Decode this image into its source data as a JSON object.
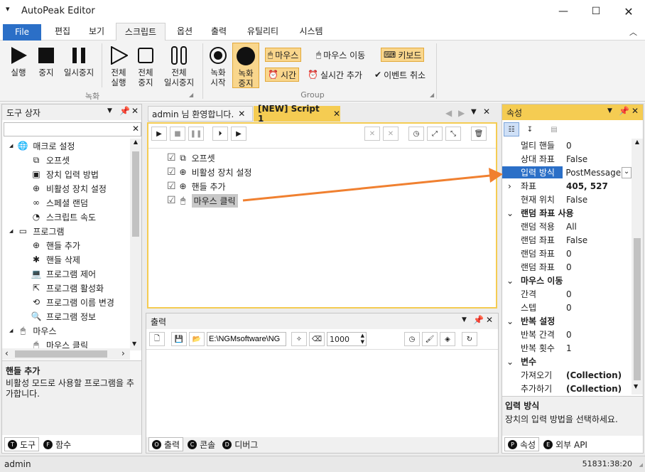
{
  "app": {
    "title": "AutoPeak Editor"
  },
  "menu": {
    "file": "File",
    "tabs": [
      "편집",
      "보기",
      "스크립트",
      "옵션",
      "출력",
      "유틸리티",
      "시스템"
    ]
  },
  "ribbon": {
    "run": "실행",
    "stop": "중지",
    "pause": "일시중지",
    "run_all": [
      "전체",
      "실행"
    ],
    "stop_all": [
      "전체",
      "중지"
    ],
    "pause_all": [
      "전체",
      "일시중지"
    ],
    "rec_start": [
      "녹화",
      "시작"
    ],
    "rec_stop": [
      "녹화",
      "중지"
    ],
    "group_record": "녹화",
    "group_group": "Group",
    "mouse": "마우스",
    "mouse_move": "마우스 이동",
    "keyboard": "키보드",
    "time": "시간",
    "realtime_add": "실시간 추가",
    "event_cancel": "이벤트 취소"
  },
  "toolbox": {
    "title": "도구 상자",
    "search_value": "",
    "items": [
      {
        "label": "매크로 설정",
        "level": 0,
        "icon": "globe-icon"
      },
      {
        "label": "오프셋",
        "level": 1,
        "icon": "offset-icon"
      },
      {
        "label": "장치 입력 방법",
        "level": 1,
        "icon": "input-method-icon"
      },
      {
        "label": "비활성 장치 설정",
        "level": 1,
        "icon": "crosshair-icon"
      },
      {
        "label": "스페셜 랜덤",
        "level": 1,
        "icon": "infinity-icon"
      },
      {
        "label": "스크립트 속도",
        "level": 1,
        "icon": "speed-icon"
      },
      {
        "label": "프로그램",
        "level": 0,
        "icon": "window-icon"
      },
      {
        "label": "핸들 추가",
        "level": 1,
        "icon": "crosshair-icon"
      },
      {
        "label": "핸들 삭제",
        "level": 1,
        "icon": "handle-delete-icon"
      },
      {
        "label": "프로그램 제어",
        "level": 1,
        "icon": "laptop-icon"
      },
      {
        "label": "프로그램 활성화",
        "level": 1,
        "icon": "activate-icon"
      },
      {
        "label": "프로그램 이름 변경",
        "level": 1,
        "icon": "rename-icon"
      },
      {
        "label": "프로그램 정보",
        "level": 1,
        "icon": "magnifier-icon"
      },
      {
        "label": "마우스",
        "level": 0,
        "icon": "mouse-icon"
      },
      {
        "label": "마우스 클릭",
        "level": 1,
        "icon": "mouse-click-icon"
      }
    ],
    "desc_title": "핸들 추가",
    "desc_text": "비활성 모드로 사용할 프로그램을 추가합니다.",
    "tabs": [
      {
        "badge": "T",
        "label": "도구"
      },
      {
        "badge": "F",
        "label": "함수"
      }
    ]
  },
  "editor": {
    "tabs": [
      "admin 님 환영합니다.",
      "[NEW] Script 1"
    ],
    "lines": [
      {
        "label": "오프셋",
        "icon": "offset-icon"
      },
      {
        "label": "비활성 장치 설정",
        "icon": "crosshair-icon"
      },
      {
        "label": "핸들 추가",
        "icon": "crosshair-icon"
      },
      {
        "label": "마우스 클릭",
        "icon": "mouse-click-icon"
      }
    ]
  },
  "output": {
    "title": "출력",
    "path": "E:\\NGMsoftware\\NG",
    "count": "1000",
    "tabs": [
      {
        "badge": "O",
        "label": "출력"
      },
      {
        "badge": "C",
        "label": "콘솔"
      },
      {
        "badge": "D",
        "label": "디버그"
      }
    ]
  },
  "properties": {
    "title": "속성",
    "rows": [
      {
        "type": "prop",
        "name": "멀티 핸들",
        "value": "0"
      },
      {
        "type": "prop",
        "name": "상대 좌표",
        "value": "False"
      },
      {
        "type": "prop",
        "name": "입력 방식",
        "value": "PostMessage",
        "selected": true
      },
      {
        "type": "prop",
        "name": "좌표",
        "value": "405, 527",
        "bold": true,
        "expand": true
      },
      {
        "type": "prop",
        "name": "현재 위치",
        "value": "False"
      },
      {
        "type": "cat",
        "name": "랜덤 좌표 사용"
      },
      {
        "type": "prop",
        "name": "랜덤 적용",
        "value": "All"
      },
      {
        "type": "prop",
        "name": "랜덤 좌표",
        "value": "False"
      },
      {
        "type": "prop",
        "name": "랜덤 좌표",
        "value": "0"
      },
      {
        "type": "prop",
        "name": "랜덤 좌표",
        "value": "0"
      },
      {
        "type": "cat",
        "name": "마우스 이동"
      },
      {
        "type": "prop",
        "name": "간격",
        "value": "0"
      },
      {
        "type": "prop",
        "name": "스텝",
        "value": "0"
      },
      {
        "type": "cat",
        "name": "반복 설정"
      },
      {
        "type": "prop",
        "name": "반복 간격",
        "value": "0"
      },
      {
        "type": "prop",
        "name": "반복 횟수",
        "value": "1"
      },
      {
        "type": "cat",
        "name": "변수"
      },
      {
        "type": "prop",
        "name": "가져오기",
        "value": "(Collection)",
        "bold": true
      },
      {
        "type": "prop",
        "name": "추가하기",
        "value": "(Collection)",
        "bold": true
      }
    ],
    "desc_title": "입력 방식",
    "desc_text": "장치의 입력 방법을 선택하세요.",
    "tabs": [
      {
        "badge": "P",
        "label": "속성"
      },
      {
        "badge": "E",
        "label": "외부 API"
      }
    ]
  },
  "status": {
    "user": "admin",
    "time": "51831:38:20"
  },
  "colors": {
    "accent": "#f5cc52",
    "file_blue": "#2b6fc7",
    "arrow": "#f08030"
  }
}
